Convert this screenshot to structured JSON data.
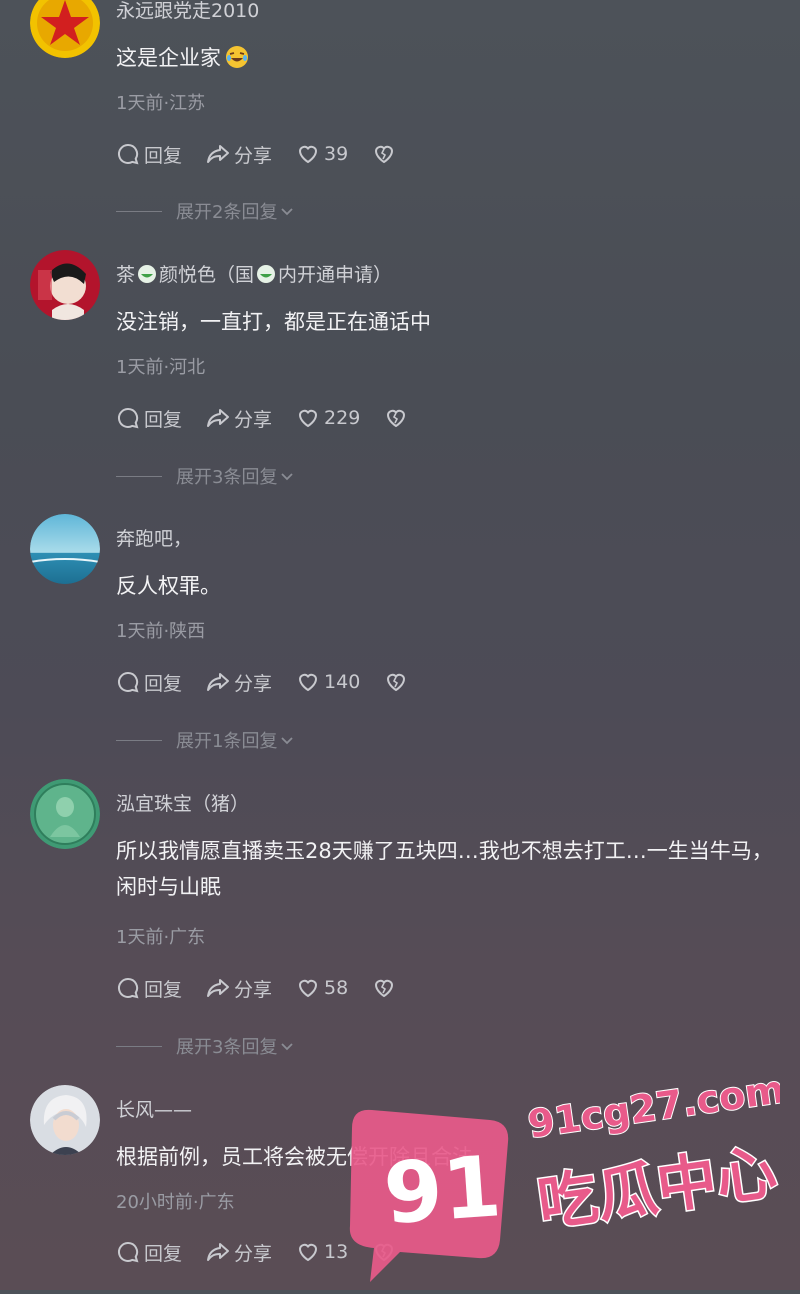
{
  "comments": [
    {
      "name": "永远跟党走2010",
      "text": "这是企业家",
      "meta": "1天前·江苏",
      "reply": "回复",
      "share": "分享",
      "likes": "39",
      "expand": "展开2条回复"
    },
    {
      "name_parts": [
        "茶",
        "颜悦色（国",
        "内开通申请）"
      ],
      "text": "没注销，一直打，都是正在通话中",
      "meta": "1天前·河北",
      "reply": "回复",
      "share": "分享",
      "likes": "229",
      "expand": "展开3条回复"
    },
    {
      "name": "奔跑吧，",
      "text": "反人权罪。",
      "meta": "1天前·陕西",
      "reply": "回复",
      "share": "分享",
      "likes": "140",
      "expand": "展开1条回复"
    },
    {
      "name": "泓宜珠宝（猪）",
      "text": "所以我情愿直播卖玉28天赚了五块四…我也不想去打工…一生当牛马，闲时与山眠",
      "meta": "1天前·广东",
      "reply": "回复",
      "share": "分享",
      "likes": "58",
      "expand": "展开3条回复"
    },
    {
      "name": "长风——",
      "text": "根据前例，员工将会被无偿开除且合法",
      "meta": "20小时前·广东",
      "reply": "回复",
      "share": "分享",
      "likes": "13"
    }
  ],
  "watermark": {
    "url": "91cg27.com",
    "number": "91",
    "title": "吃瓜中心"
  },
  "colors": {
    "watermark_pink": "#e85a8a",
    "text": "#f2f2f4",
    "meta": "#9a9ca4"
  }
}
